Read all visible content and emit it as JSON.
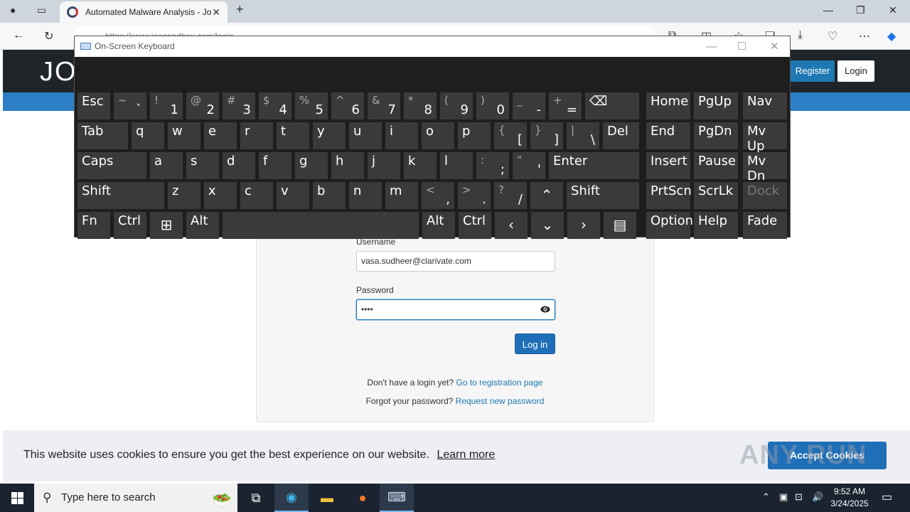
{
  "browser": {
    "tab_title": "Automated Malware Analysis - Jo",
    "url": "https://www.joesandbox.com/login"
  },
  "site": {
    "logo_text": "JO",
    "register_label": "Register",
    "login_label": "Login"
  },
  "form": {
    "username_label": "Username",
    "username_value": "vasa.sudheer@clarivate.com",
    "password_label": "Password",
    "password_value": "••••",
    "login_button": "Log in",
    "no_login_text": "Don't have a login yet?",
    "register_link": "Go to registration page",
    "forgot_text": "Forgot your password?",
    "reset_link": "Request new password"
  },
  "cookie": {
    "message": "This website uses cookies to ensure you get the best experience on our website.",
    "learn_more": "Learn more",
    "accept": "Accept Cookies",
    "watermark": "ANY RUN"
  },
  "osk": {
    "title": "On-Screen Keyboard",
    "keys": [
      {
        "name": "key-esc",
        "main": "Esc"
      },
      {
        "name": "key-backtick",
        "top": "~",
        "bottom": "`"
      },
      {
        "name": "key-1",
        "top": "!",
        "bottom": "1"
      },
      {
        "name": "key-2",
        "top": "@",
        "bottom": "2"
      },
      {
        "name": "key-3",
        "top": "#",
        "bottom": "3"
      },
      {
        "name": "key-4",
        "top": "$",
        "bottom": "4"
      },
      {
        "name": "key-5",
        "top": "%",
        "bottom": "5"
      },
      {
        "name": "key-6",
        "top": "^",
        "bottom": "6"
      },
      {
        "name": "key-7",
        "top": "&",
        "bottom": "7"
      },
      {
        "name": "key-8",
        "top": "*",
        "bottom": "8"
      },
      {
        "name": "key-9",
        "top": "(",
        "bottom": "9"
      },
      {
        "name": "key-0",
        "top": ")",
        "bottom": "0"
      },
      {
        "name": "key-minus",
        "top": "_",
        "bottom": "-"
      },
      {
        "name": "key-equals",
        "top": "+",
        "bottom": "="
      },
      {
        "name": "key-backspace",
        "main": "⌫"
      },
      {
        "name": "key-home",
        "main": "Home"
      },
      {
        "name": "key-pgup",
        "main": "PgUp"
      },
      {
        "name": "key-nav",
        "main": "Nav"
      },
      {
        "name": "key-tab",
        "main": "Tab"
      },
      {
        "name": "key-q",
        "main": "q"
      },
      {
        "name": "key-w",
        "main": "w"
      },
      {
        "name": "key-e",
        "main": "e"
      },
      {
        "name": "key-r",
        "main": "r"
      },
      {
        "name": "key-t",
        "main": "t"
      },
      {
        "name": "key-y",
        "main": "y"
      },
      {
        "name": "key-u",
        "main": "u"
      },
      {
        "name": "key-i",
        "main": "i"
      },
      {
        "name": "key-o",
        "main": "o"
      },
      {
        "name": "key-p",
        "main": "p"
      },
      {
        "name": "key-lbracket",
        "top": "{",
        "bottom": "["
      },
      {
        "name": "key-rbracket",
        "top": "}",
        "bottom": "]"
      },
      {
        "name": "key-backslash",
        "top": "|",
        "bottom": "\\"
      },
      {
        "name": "key-del",
        "main": "Del"
      },
      {
        "name": "key-end",
        "main": "End"
      },
      {
        "name": "key-pgdn",
        "main": "PgDn"
      },
      {
        "name": "key-mvup",
        "main": "Mv Up"
      },
      {
        "name": "key-caps",
        "main": "Caps"
      },
      {
        "name": "key-a",
        "main": "a"
      },
      {
        "name": "key-s",
        "main": "s"
      },
      {
        "name": "key-d",
        "main": "d"
      },
      {
        "name": "key-f",
        "main": "f"
      },
      {
        "name": "key-g",
        "main": "g"
      },
      {
        "name": "key-h",
        "main": "h"
      },
      {
        "name": "key-j",
        "main": "j"
      },
      {
        "name": "key-k",
        "main": "k"
      },
      {
        "name": "key-l",
        "main": "l"
      },
      {
        "name": "key-semicolon",
        "top": ":",
        "bottom": ";"
      },
      {
        "name": "key-quote",
        "top": "\"",
        "bottom": "'"
      },
      {
        "name": "key-enter",
        "main": "Enter"
      },
      {
        "name": "key-insert",
        "main": "Insert"
      },
      {
        "name": "key-pause",
        "main": "Pause"
      },
      {
        "name": "key-mvdn",
        "main": "Mv Dn"
      },
      {
        "name": "key-shift-left",
        "main": "Shift"
      },
      {
        "name": "key-z",
        "main": "z"
      },
      {
        "name": "key-x",
        "main": "x"
      },
      {
        "name": "key-c",
        "main": "c"
      },
      {
        "name": "key-v",
        "main": "v"
      },
      {
        "name": "key-b",
        "main": "b"
      },
      {
        "name": "key-n",
        "main": "n"
      },
      {
        "name": "key-m",
        "main": "m"
      },
      {
        "name": "key-comma",
        "top": "<",
        "bottom": ","
      },
      {
        "name": "key-period",
        "top": ">",
        "bottom": "."
      },
      {
        "name": "key-slash",
        "top": "?",
        "bottom": "/"
      },
      {
        "name": "key-up",
        "center": "⌃"
      },
      {
        "name": "key-shift-right",
        "main": "Shift"
      },
      {
        "name": "key-prtscn",
        "main": "PrtScn"
      },
      {
        "name": "key-scrlk",
        "main": "ScrLk"
      },
      {
        "name": "key-dock",
        "main": "Dock"
      },
      {
        "name": "key-fn",
        "main": "Fn"
      },
      {
        "name": "key-ctrl-left",
        "main": "Ctrl"
      },
      {
        "name": "key-win",
        "center": "⊞"
      },
      {
        "name": "key-alt-left",
        "main": "Alt"
      },
      {
        "name": "key-space",
        "main": ""
      },
      {
        "name": "key-alt-right",
        "main": "Alt"
      },
      {
        "name": "key-ctrl-right",
        "main": "Ctrl"
      },
      {
        "name": "key-left",
        "center": "‹"
      },
      {
        "name": "key-down",
        "center": "⌄"
      },
      {
        "name": "key-right",
        "center": "›"
      },
      {
        "name": "key-menu",
        "center": "▤"
      },
      {
        "name": "key-options",
        "main": "Options"
      },
      {
        "name": "key-help",
        "main": "Help"
      },
      {
        "name": "key-fade",
        "main": "Fade"
      }
    ]
  },
  "taskbar": {
    "search_placeholder": "Type here to search",
    "time": "9:52 AM",
    "date": "3/24/2025"
  }
}
